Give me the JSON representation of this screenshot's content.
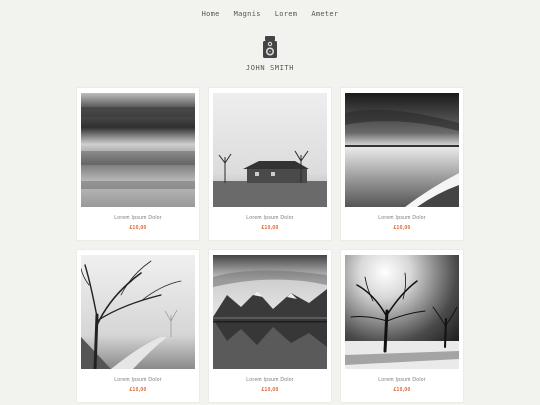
{
  "nav": {
    "items": [
      {
        "label": "Home"
      },
      {
        "label": "Magnis"
      },
      {
        "label": "Lorem"
      },
      {
        "label": "Ameter"
      }
    ]
  },
  "brand": {
    "name": "JOHN SMITH",
    "logo_icon": "camera-icon"
  },
  "colors": {
    "background": "#f2f2ee",
    "price": "#e06030",
    "text": "#555555"
  },
  "products": [
    {
      "title": "Lorem Ipsum Dolor",
      "price": "£10,00"
    },
    {
      "title": "Lorem Ipsum Dolor",
      "price": "£10,00"
    },
    {
      "title": "Lorem Ipsum Dolor",
      "price": "£10,00"
    },
    {
      "title": "Lorem Ipsum Dolor",
      "price": "£10,00"
    },
    {
      "title": "Lorem Ipsum Dolor",
      "price": "£10,00"
    },
    {
      "title": "Lorem Ipsum Dolor",
      "price": "£10,00"
    }
  ]
}
